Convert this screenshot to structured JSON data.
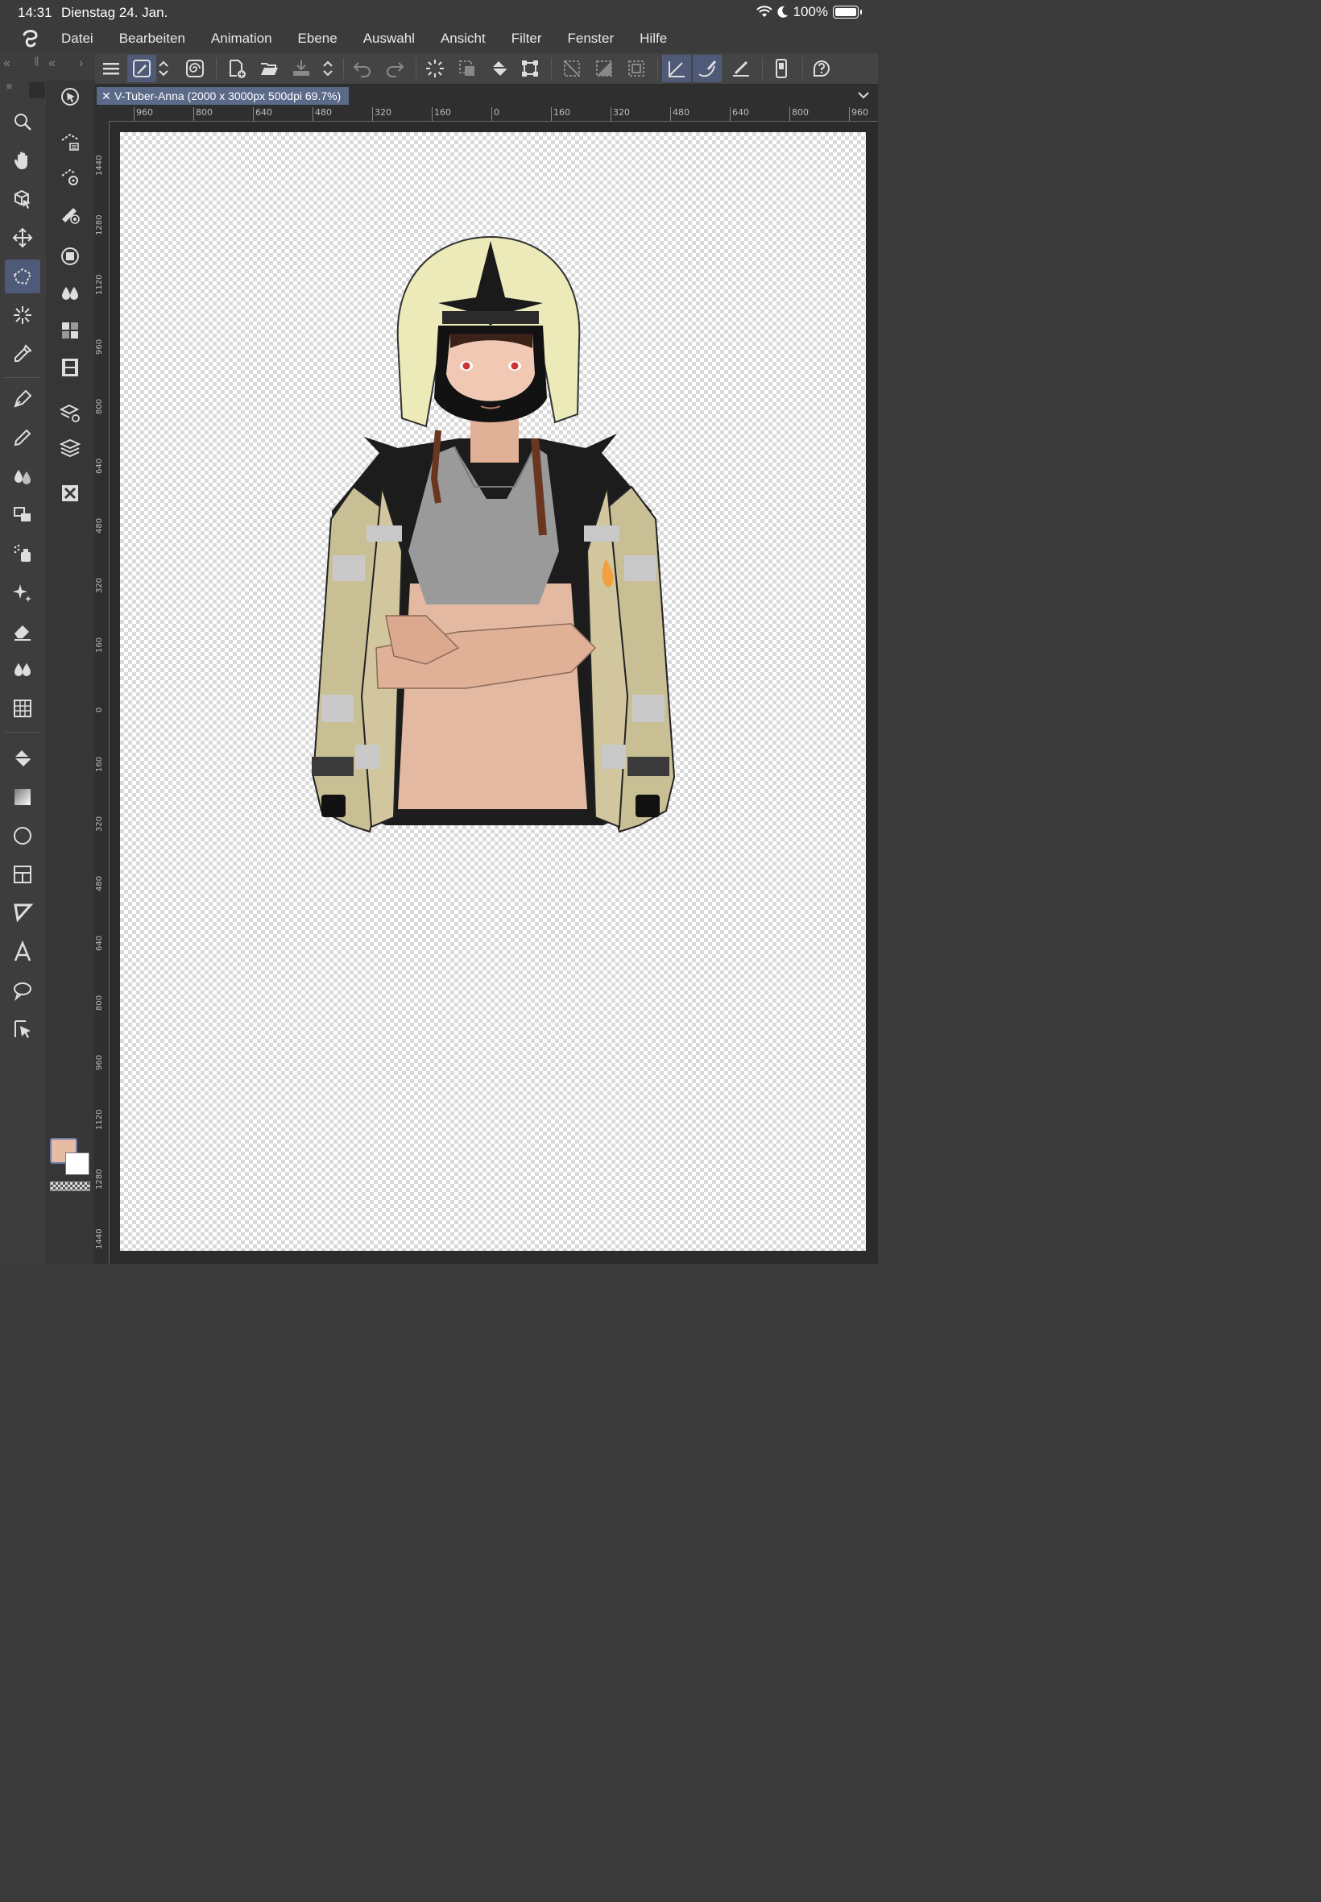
{
  "status": {
    "time": "14:31",
    "date": "Dienstag 24. Jan.",
    "battery": "100%"
  },
  "menu": [
    "Datei",
    "Bearbeiten",
    "Animation",
    "Ebene",
    "Auswahl",
    "Ansicht",
    "Filter",
    "Fenster",
    "Hilfe"
  ],
  "document": {
    "tab_title": "V-Tuber-Anna (2000 x 3000px 500dpi 69.7%)"
  },
  "ruler": {
    "horizontal": [
      "960",
      "800",
      "640",
      "480",
      "320",
      "160",
      "0",
      "160",
      "320",
      "480",
      "640",
      "800",
      "960"
    ],
    "vertical": [
      "1440",
      "1280",
      "1120",
      "960",
      "800",
      "640",
      "480",
      "320",
      "160",
      "0",
      "160",
      "320",
      "480",
      "640",
      "800",
      "960",
      "1120",
      "1280",
      "1440"
    ]
  },
  "tools": [
    "zoom-tool",
    "hand-tool",
    "operation-tool",
    "move-layer-tool",
    "selection-tool",
    "auto-select-tool",
    "eyedropper-tool",
    "pen-tool",
    "pencil-tool",
    "brush-tool",
    "decoration-tool",
    "airbrush-tool",
    "effect-tool",
    "eraser-tool",
    "blend-tool",
    "perspective-tool",
    "fill-tool",
    "gradient-tool",
    "figure-tool",
    "frame-tool",
    "ruler-tool",
    "text-tool",
    "balloon-tool",
    "correct-line-tool"
  ],
  "colors": {
    "main": "#e8bca4",
    "sub": "#ffffff",
    "accent": "#4e5a78"
  },
  "artwork": {
    "description_hidden": ""
  }
}
